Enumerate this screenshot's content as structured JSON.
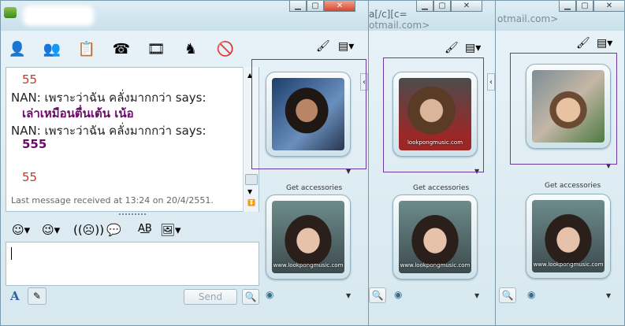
{
  "window3": {
    "title_fragment": "otmail.com>"
  },
  "window2": {
    "title_line1": "a[/c][c=",
    "title_line2": "otmail.com>",
    "get_accessories": "Get accessories",
    "watermark": "www.lookpongmusic.com"
  },
  "window1": {
    "toolbar_icons": [
      "add-contact-icon",
      "contacts-icon",
      "share-icon",
      "call-icon",
      "video-icon",
      "games-icon",
      "block-icon"
    ],
    "chat": {
      "lines": [
        {
          "type": "red",
          "text": "55"
        },
        {
          "type": "sender",
          "text": "NAN: เพราะว่าฉัน คลั่งมากกว่า says:"
        },
        {
          "type": "msg",
          "text": "เล่าเหมือนตื่นเต้น เน้อ"
        },
        {
          "type": "sender",
          "text": "NAN: เพราะว่าฉัน คลั่งมากกว่า says:"
        },
        {
          "type": "msg",
          "text": "555"
        },
        {
          "type": "red",
          "text": "55"
        }
      ],
      "status": "Last message received at 13:24 on 20/4/2551."
    },
    "send_label": "Send",
    "get_accessories": "Get accessories",
    "watermark": "www.lookpongmusic.com",
    "small_watermark": "lookpongmusic.com"
  },
  "colors": {
    "purple_text": "#6a0a6a",
    "red_text": "#c0392b",
    "selection": "#6b3aa0"
  }
}
